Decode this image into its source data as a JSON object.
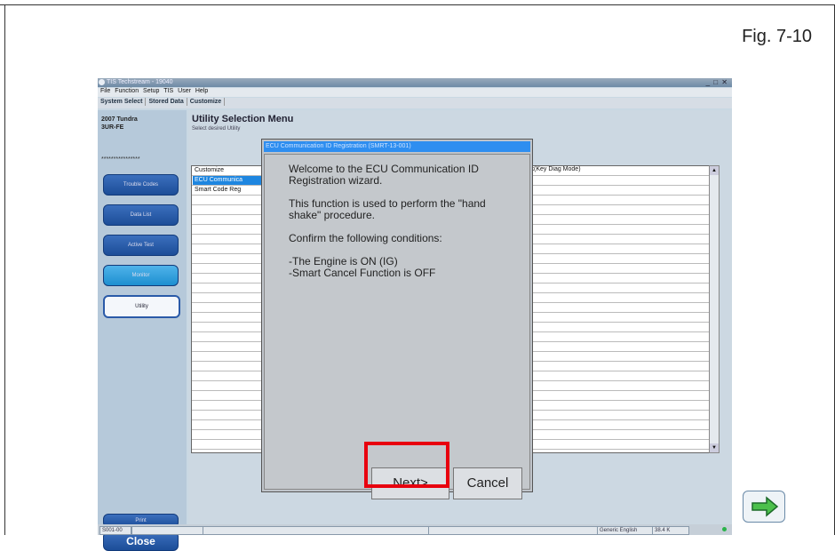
{
  "figure_label": "Fig. 7-10",
  "app": {
    "title": "TIS Techstream - 19040",
    "menu": [
      "File",
      "Function",
      "Setup",
      "TIS",
      "User",
      "Help"
    ],
    "toolbar": [
      "System Select",
      "Stored Data",
      "Customize"
    ],
    "window_buttons": "_ □ ✕"
  },
  "sidebar": {
    "vehicle_line1": "2007 Tundra",
    "vehicle_line2": "3UR-FE",
    "stars": "****************",
    "buttons": {
      "trouble_codes": "Trouble Codes",
      "data_list": "Data List",
      "active_test": "Active Test",
      "monitor": "Monitor",
      "utility": "Utility",
      "print": "Print",
      "close": "Close"
    }
  },
  "main": {
    "title": "Utility Selection Menu",
    "subtitle": "Select desired Utility",
    "list_items": [
      "Customize",
      "ECU Communica",
      "Smart Code Reg"
    ],
    "right_item": "ck(Key Diag Mode)"
  },
  "dialog": {
    "title": "ECU Communication ID Registration (SMRT-13-001)",
    "line1": "Welcome to the ECU Communication ID",
    "line2": "Registration wizard.",
    "line3": "This function is used to perform the \"hand",
    "line4": "shake\" procedure.",
    "line5": "Confirm the following conditions:",
    "line6": "-The Engine is ON (IG)",
    "line7": "-Smart Cancel Function is OFF",
    "next_label": "Next>",
    "cancel_label": "Cancel"
  },
  "statusbar": {
    "left": "S001-00",
    "lang": "Generic English",
    "rate": "38.4 K"
  },
  "colors": {
    "highlight": "#e8000e",
    "dialog_title": "#2e8ef0",
    "selection": "#1e86e0"
  }
}
